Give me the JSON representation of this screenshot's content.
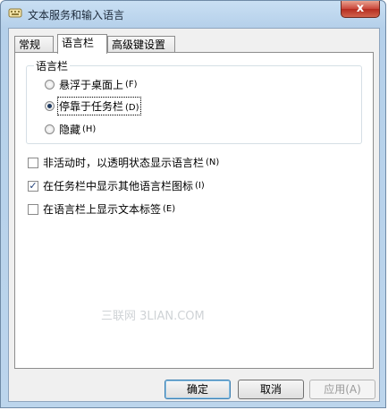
{
  "window": {
    "title": "文本服务和输入语言",
    "close_label": "x"
  },
  "tabs": [
    {
      "label": "常规",
      "active": false
    },
    {
      "label": "语言栏",
      "active": true
    },
    {
      "label": "高级键设置",
      "active": false
    }
  ],
  "language_bar_group": {
    "label": "语言栏",
    "options": [
      {
        "label": "悬浮于桌面上",
        "key": "(F)",
        "checked": false
      },
      {
        "label": "停靠于任务栏",
        "key": "(D)",
        "checked": true
      },
      {
        "label": "隐藏",
        "key": "(H)",
        "checked": false
      }
    ]
  },
  "checkboxes": [
    {
      "label": "非活动时，以透明状态显示语言栏",
      "key": "(N)",
      "checked": false
    },
    {
      "label": "在任务栏中显示其他语言栏图标",
      "key": "(I)",
      "checked": true
    },
    {
      "label": "在语言栏上显示文本标签",
      "key": "(E)",
      "checked": false
    }
  ],
  "buttons": {
    "ok": "确定",
    "cancel": "取消",
    "apply": "应用(A)"
  },
  "watermark": "三联网 3LIAN.COM",
  "colors": {
    "titlebar": "#bcd5ec",
    "close_button": "#c9463a",
    "default_button_border": "#3c7fb1"
  }
}
